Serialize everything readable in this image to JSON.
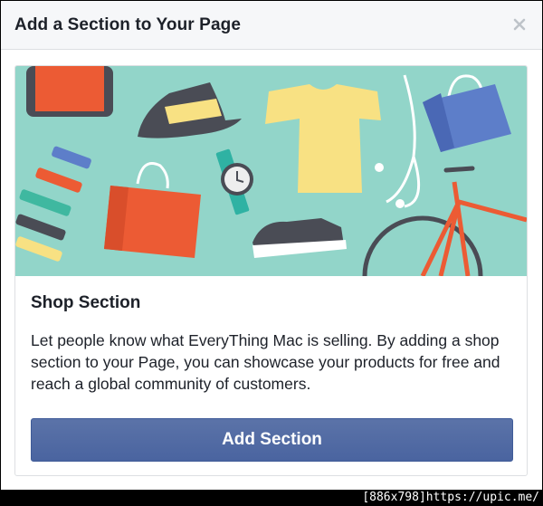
{
  "dialog": {
    "title": "Add a Section to Your Page",
    "close_icon": "close-icon"
  },
  "section": {
    "title": "Shop Section",
    "description": "Let people know what EveryThing Mac is selling. By adding a shop section to your Page, you can showcase your products for free and reach a global community of customers.",
    "button_label": "Add Section",
    "banner_icons": [
      "orange-picture-icon",
      "hat-icon",
      "t-shirt-icon",
      "shopping-bag-icon",
      "earphones-icon",
      "xylophone-icon",
      "watch-icon",
      "shopping-bag-icon",
      "sneaker-icon",
      "bicycle-icon"
    ]
  },
  "watermark": "[886x798]https://upic.me/",
  "colors": {
    "banner_bg": "#92d5c9",
    "button": "#4e69a2",
    "accent_orange": "#ec5b34"
  }
}
